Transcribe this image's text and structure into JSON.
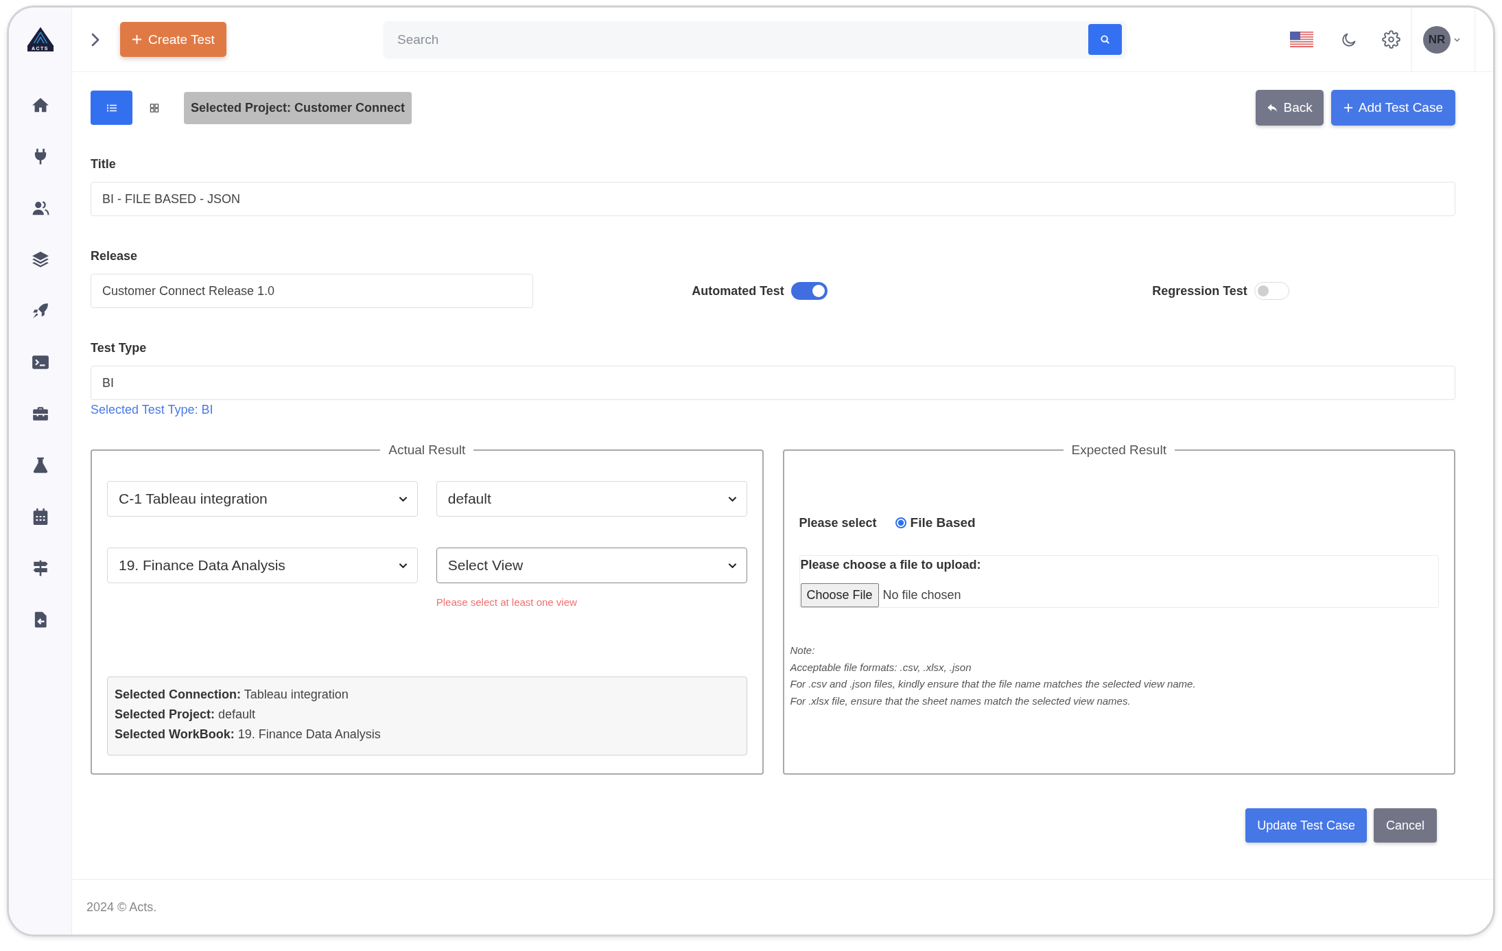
{
  "logo": {
    "text": "ACTS"
  },
  "topbar": {
    "create_button": "Create Test",
    "search": {
      "placeholder": "Search"
    },
    "user": {
      "initials": "NR"
    }
  },
  "toolbar": {
    "views": [
      {
        "kind": "list",
        "selected": true
      },
      {
        "kind": "grid",
        "selected": false
      }
    ],
    "project_badge": "Selected Project: Customer Connect",
    "buttons": [
      {
        "label": "Back",
        "kind": "back"
      },
      {
        "label": "Add Test Case",
        "kind": "add"
      }
    ]
  },
  "form": {
    "title": {
      "label": "Title",
      "value": "BI - FILE BASED - JSON"
    },
    "release": {
      "label": "Release",
      "value": "Customer Connect Release 1.0"
    },
    "toggles": [
      {
        "label": "Automated Test",
        "on": true
      },
      {
        "label": "Regression Test",
        "on": false
      }
    ],
    "test_type": {
      "label": "Test Type",
      "value": "BI",
      "note": "Selected Test Type: BI"
    }
  },
  "actual_result": {
    "legend": "Actual Result",
    "selects": [
      {
        "value": "C-1 Tableau integration"
      },
      {
        "value": "default"
      },
      {
        "value": "19. Finance Data Analysis"
      },
      {
        "value": "Select View",
        "error": "Please select at least one view"
      }
    ],
    "summary": [
      "**Selected Connection:** Tableau integration",
      "**Selected Project:** default",
      "**Selected WorkBook:** 19. Finance Data Analysis"
    ]
  },
  "expected_result": {
    "legend": "Expected Result",
    "prompt": "Please select",
    "options": [
      {
        "label": "File Based",
        "selected": true
      }
    ],
    "upload": {
      "label": "Please choose a file to upload:",
      "button": "Choose File",
      "status": "No file chosen"
    },
    "note": [
      "Note:",
      "Acceptable file formats: .csv, .xlsx, .json",
      "For .csv and .json files, kindly ensure that the file name matches the selected view name.",
      "For .xlsx file, ensure that the sheet names match the selected view names."
    ]
  },
  "actions": [
    {
      "label": "Update Test Case",
      "kind": "primary"
    },
    {
      "label": "Cancel",
      "kind": "secondary"
    }
  ],
  "footer": "2024 © Acts."
}
